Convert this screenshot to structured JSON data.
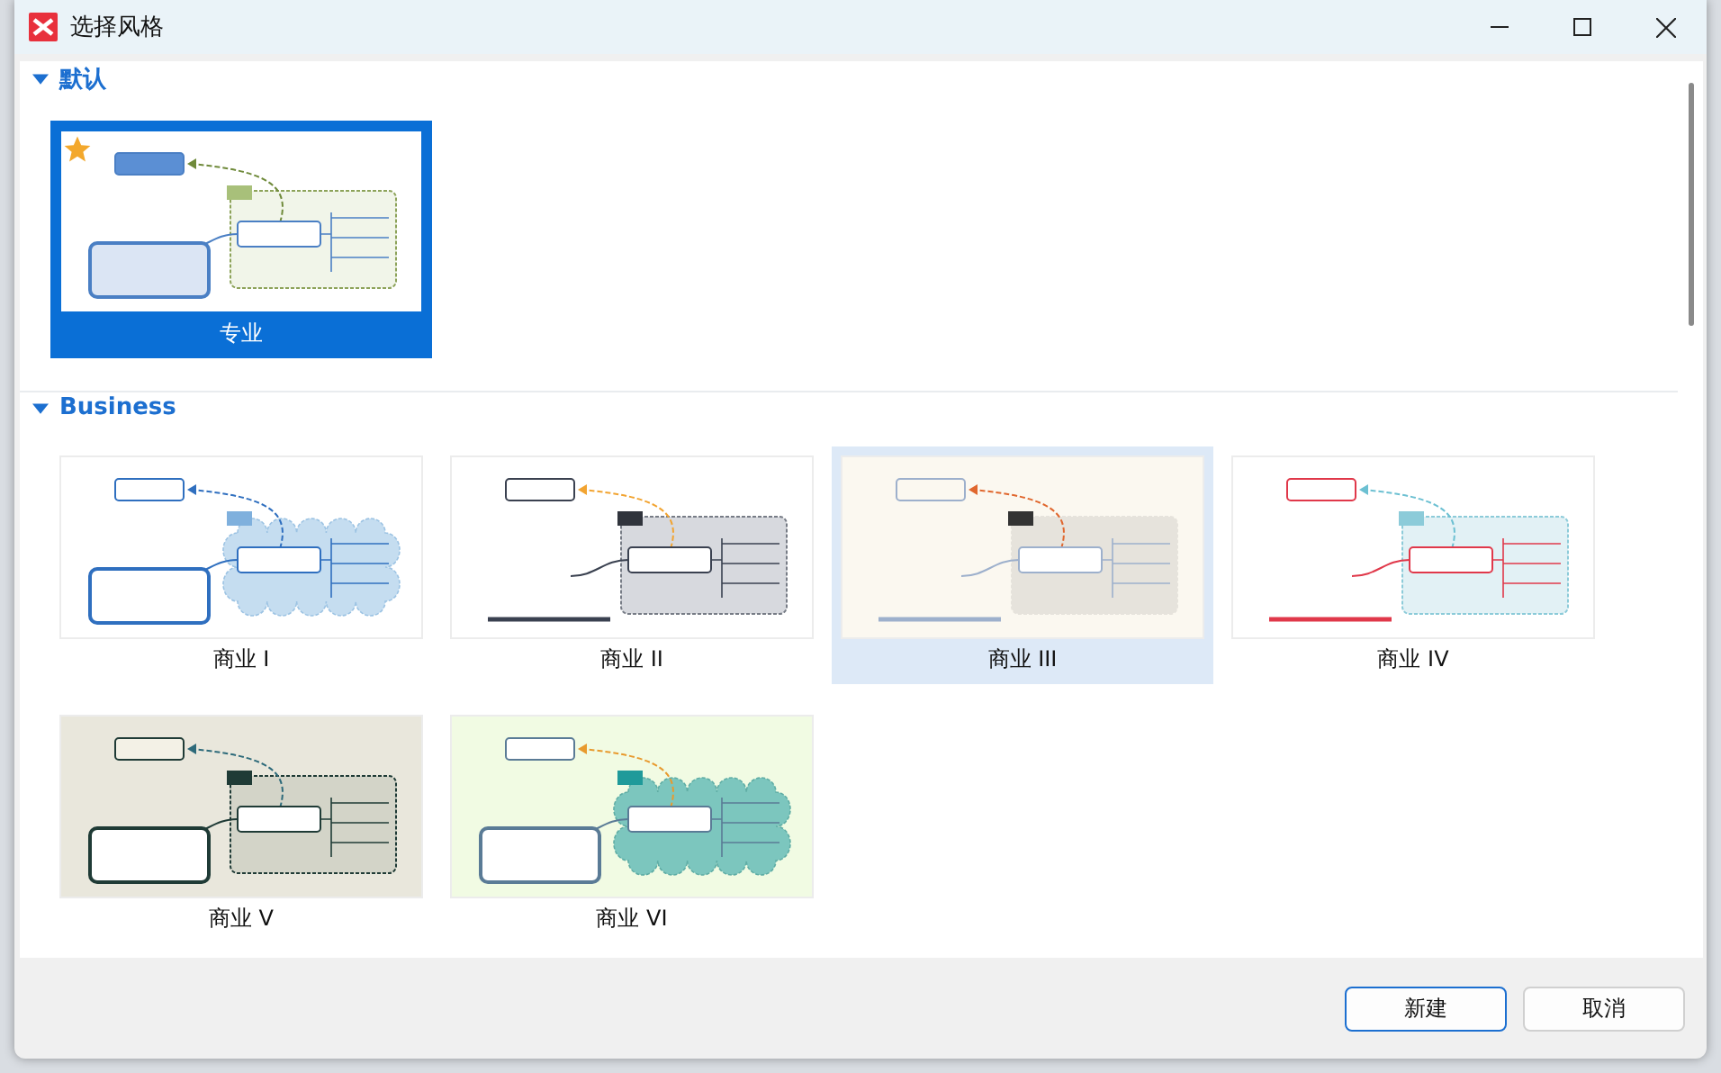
{
  "window": {
    "title": "选择风格"
  },
  "sections": [
    {
      "title": "默认",
      "expanded": true,
      "styles": [
        {
          "label": "专业",
          "kind": "classic",
          "selected": true,
          "highlighted": false,
          "favorite": true
        }
      ]
    },
    {
      "title": "Business",
      "expanded": true,
      "styles": [
        {
          "label": "商业 I",
          "kind": "cloud",
          "selected": false,
          "highlighted": false,
          "favorite": false
        },
        {
          "label": "商业 II",
          "kind": "underline",
          "selected": false,
          "highlighted": false,
          "favorite": false
        },
        {
          "label": "商业 III",
          "kind": "soft",
          "selected": false,
          "highlighted": true,
          "favorite": false
        },
        {
          "label": "商业 IV",
          "kind": "accent",
          "selected": false,
          "highlighted": false,
          "favorite": false
        },
        {
          "label": "商业 V",
          "kind": "frame",
          "selected": false,
          "highlighted": false,
          "favorite": false
        },
        {
          "label": "商业 VI",
          "kind": "ocean",
          "selected": false,
          "highlighted": false,
          "favorite": false
        }
      ]
    }
  ],
  "buttons": [
    {
      "label": "新建",
      "default": true
    },
    {
      "label": "取消",
      "default": false
    }
  ]
}
